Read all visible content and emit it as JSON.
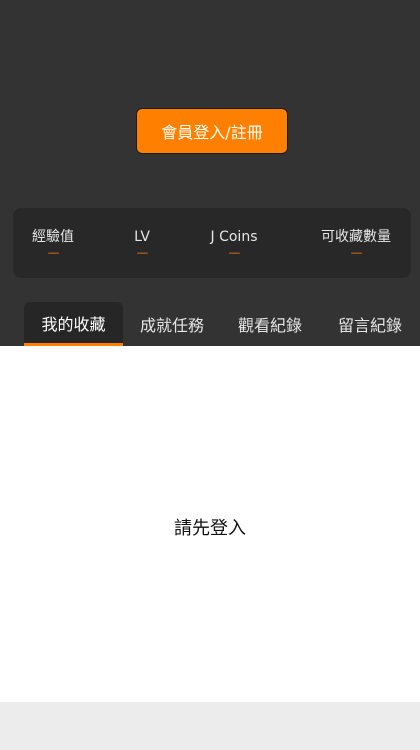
{
  "header": {
    "login_button": "會員登入/註冊"
  },
  "stats": [
    {
      "label": "經驗值",
      "value": "----"
    },
    {
      "label": "LV",
      "value": "----"
    },
    {
      "label": "J Coins",
      "value": "----"
    },
    {
      "label": "可收藏數量",
      "value": "----"
    }
  ],
  "tabs": [
    {
      "label": "我的收藏",
      "active": true
    },
    {
      "label": "成就任務",
      "active": false
    },
    {
      "label": "觀看紀錄",
      "active": false
    },
    {
      "label": "留言紀錄",
      "active": false
    }
  ],
  "content": {
    "message": "請先登入"
  },
  "colors": {
    "accent": "#ff8000",
    "header_bg": "#333333",
    "card_bg": "#282828"
  }
}
